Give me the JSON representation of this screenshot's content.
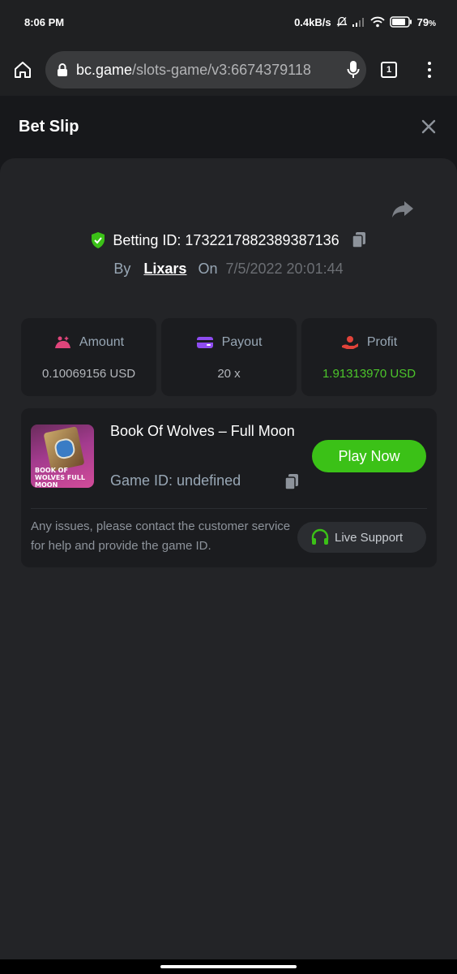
{
  "status_bar": {
    "time": "8:06 PM",
    "net_speed": "0.4kB/s",
    "battery": "79"
  },
  "browser": {
    "url_domain": "bc.game",
    "url_path": "/slots-game/v3:6674379118",
    "tab_count": "1"
  },
  "header": {
    "title": "Bet Slip"
  },
  "bet": {
    "betting_id_label": "Betting ID:",
    "betting_id": "1732217882389387136",
    "by_label": "By",
    "user": "Lixars",
    "on_label": "On",
    "date": "7/5/2022 20:01:44"
  },
  "stats": [
    {
      "label": "Amount",
      "value": "0.10069156 USD",
      "icon": "amount-icon",
      "color": "#e0457b"
    },
    {
      "label": "Payout",
      "value": "20 x",
      "icon": "payout-icon",
      "color": "#8e4cf0"
    },
    {
      "label": "Profit",
      "value": "1.91313970 USD",
      "icon": "profit-icon",
      "color": "#e2433a"
    }
  ],
  "game": {
    "title": "Book Of Wolves – Full Moon",
    "game_id_label": "Game ID:",
    "game_id": "undefined",
    "thumb_text": "BOOK OF WOLVES FULL MOON",
    "play_label": "Play Now"
  },
  "support": {
    "text": "Any issues, please contact the customer service for help and provide the game ID.",
    "button_label": "Live Support"
  },
  "colors": {
    "accent_green": "#3bc117",
    "profit_green": "#4cc52b"
  }
}
